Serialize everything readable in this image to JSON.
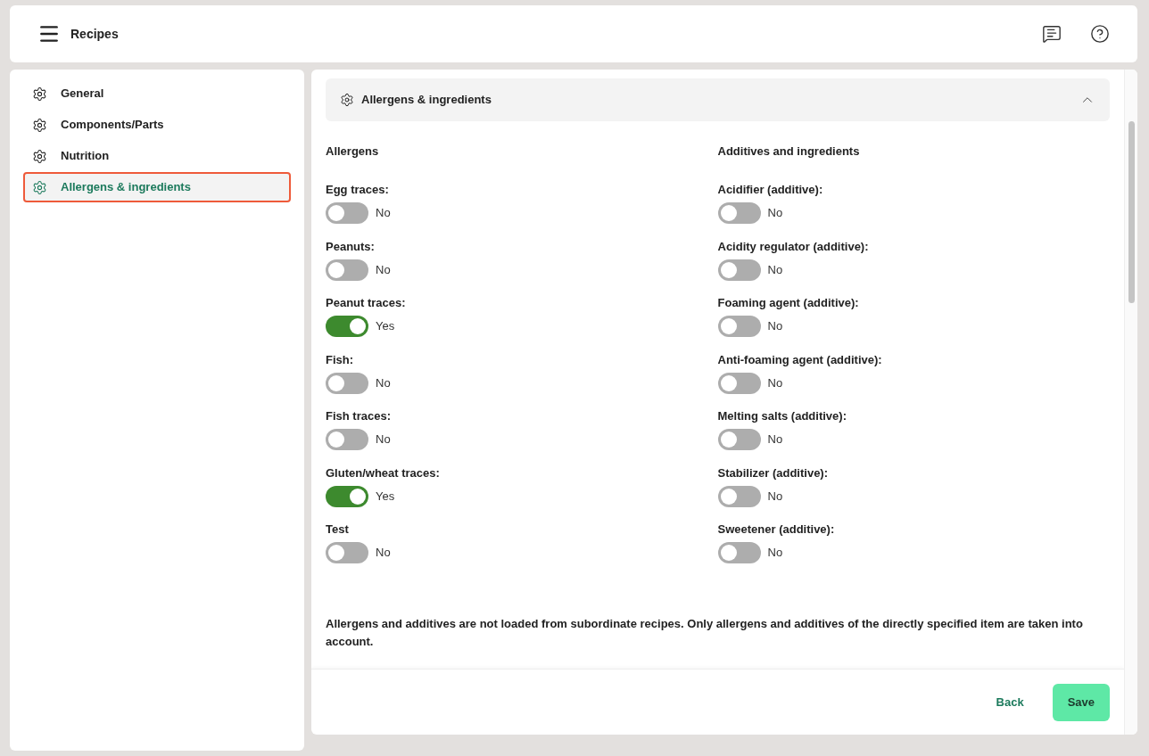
{
  "header": {
    "title": "Recipes"
  },
  "sidebar": {
    "items": [
      {
        "label": "General",
        "selected": false
      },
      {
        "label": "Components/Parts",
        "selected": false
      },
      {
        "label": "Nutrition",
        "selected": false
      },
      {
        "label": "Allergens & ingredients",
        "selected": true
      }
    ]
  },
  "section": {
    "title": "Allergens & ingredients",
    "expanded": true
  },
  "columns": [
    {
      "heading": "Allergens",
      "fields": [
        {
          "label": "Egg traces:",
          "on": false,
          "value": "No"
        },
        {
          "label": "Peanuts:",
          "on": false,
          "value": "No"
        },
        {
          "label": "Peanut traces:",
          "on": true,
          "value": "Yes"
        },
        {
          "label": "Fish:",
          "on": false,
          "value": "No"
        },
        {
          "label": "Fish traces:",
          "on": false,
          "value": "No"
        },
        {
          "label": "Gluten/wheat traces:",
          "on": true,
          "value": "Yes"
        },
        {
          "label": "Test",
          "on": false,
          "value": "No"
        }
      ]
    },
    {
      "heading": "Additives and ingredients",
      "fields": [
        {
          "label": "Acidifier (additive):",
          "on": false,
          "value": "No"
        },
        {
          "label": "Acidity regulator (additive):",
          "on": false,
          "value": "No"
        },
        {
          "label": "Foaming agent (additive):",
          "on": false,
          "value": "No"
        },
        {
          "label": "Anti-foaming agent (additive):",
          "on": false,
          "value": "No"
        },
        {
          "label": "Melting salts (additive):",
          "on": false,
          "value": "No"
        },
        {
          "label": "Stabilizer (additive):",
          "on": false,
          "value": "No"
        },
        {
          "label": "Sweetener (additive):",
          "on": false,
          "value": "No"
        }
      ]
    }
  ],
  "note": "Allergens and additives are not loaded from subordinate recipes. Only allergens and additives of the directly specified item are taken into account.",
  "footer": {
    "buttons": [
      "Back",
      "Save"
    ]
  }
}
